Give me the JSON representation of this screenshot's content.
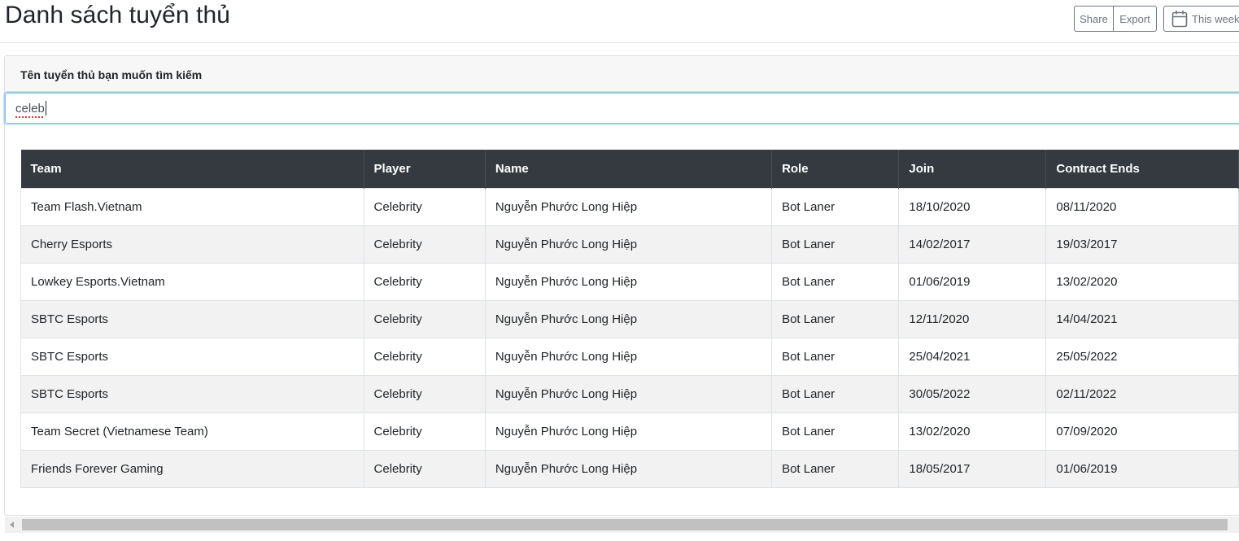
{
  "header": {
    "title": "Danh sách tuyển thủ",
    "share_label": "Share",
    "export_label": "Export",
    "week_label": "This week",
    "calendar_icon": "calendar-icon"
  },
  "search": {
    "label": "Tên tuyển thủ bạn muốn tìm kiếm",
    "value": "celeb"
  },
  "table": {
    "columns": [
      "Team",
      "Player",
      "Name",
      "Role",
      "Join",
      "Contract Ends"
    ],
    "rows": [
      [
        "Team Flash.Vietnam",
        "Celebrity",
        "Nguyễn Phước Long Hiệp",
        "Bot Laner",
        "18/10/2020",
        "08/11/2020"
      ],
      [
        "Cherry Esports",
        "Celebrity",
        "Nguyễn Phước Long Hiệp",
        "Bot Laner",
        "14/02/2017",
        "19/03/2017"
      ],
      [
        "Lowkey Esports.Vietnam",
        "Celebrity",
        "Nguyễn Phước Long Hiệp",
        "Bot Laner",
        "01/06/2019",
        "13/02/2020"
      ],
      [
        "SBTC Esports",
        "Celebrity",
        "Nguyễn Phước Long Hiệp",
        "Bot Laner",
        "12/11/2020",
        "14/04/2021"
      ],
      [
        "SBTC Esports",
        "Celebrity",
        "Nguyễn Phước Long Hiệp",
        "Bot Laner",
        "25/04/2021",
        "25/05/2022"
      ],
      [
        "SBTC Esports",
        "Celebrity",
        "Nguyễn Phước Long Hiệp",
        "Bot Laner",
        "30/05/2022",
        "02/11/2022"
      ],
      [
        "Team Secret (Vietnamese Team)",
        "Celebrity",
        "Nguyễn Phước Long Hiệp",
        "Bot Laner",
        "13/02/2020",
        "07/09/2020"
      ],
      [
        "Friends Forever Gaming",
        "Celebrity",
        "Nguyễn Phước Long Hiệp",
        "Bot Laner",
        "18/05/2017",
        "01/06/2019"
      ]
    ]
  },
  "scrollbar": {
    "arrow_icon": "chevron-left-icon"
  }
}
